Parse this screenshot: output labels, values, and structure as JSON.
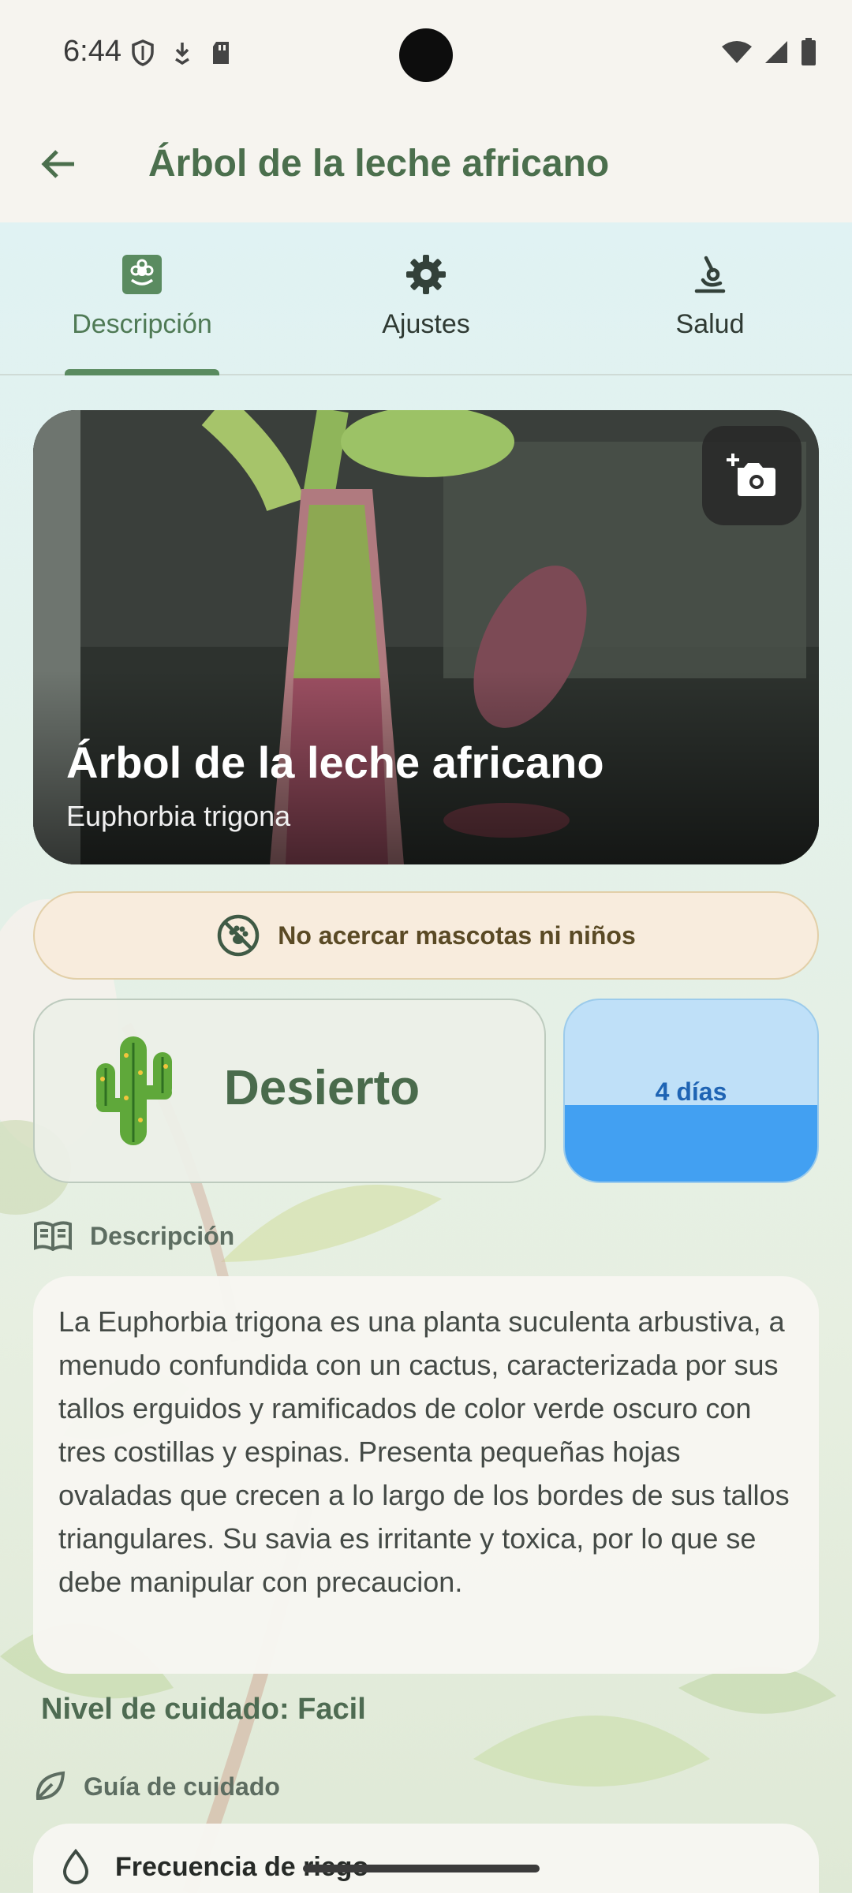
{
  "status_bar": {
    "time": "6:44"
  },
  "app_bar": {
    "title": "Árbol de la leche africano"
  },
  "tabs": [
    {
      "label": "Descripción",
      "icon": "flower-badge-icon",
      "active": true
    },
    {
      "label": "Ajustes",
      "icon": "gear-icon",
      "active": false
    },
    {
      "label": "Salud",
      "icon": "microscope-icon",
      "active": false
    }
  ],
  "hero": {
    "title": "Árbol de la leche africano",
    "subtitle": "Euphorbia trigona"
  },
  "warning": {
    "text": "No acercar mascotas ni niños",
    "icon": "no-pets-icon"
  },
  "climate": {
    "label": "Desierto",
    "icon": "cactus-icon"
  },
  "watering": {
    "label": "4 días",
    "fill_fraction": 0.42
  },
  "description_section": {
    "title": "Descripción",
    "icon": "book-icon",
    "text": "La Euphorbia trigona es una planta suculenta arbustiva, a menudo confundida con un cactus, caracterizada por sus tallos erguidos y ramificados de color verde oscuro con tres costillas y espinas. Presenta pequeñas hojas ovaladas que crecen a lo largo de los bordes de sus tallos triangulares. Su savia es irritante y toxica, por lo que se debe manipular con precaucion."
  },
  "care_level": "Nivel de cuidado: Facil",
  "care_guide": {
    "title": "Guía de cuidado",
    "icon": "leaf-icon",
    "items": [
      {
        "label": "Frecuencia de riego",
        "icon": "water-drop-icon"
      }
    ]
  },
  "colors": {
    "accent": "#4f7a55",
    "water": "#42a0f2",
    "warning_bg": "#f8ecdd"
  }
}
